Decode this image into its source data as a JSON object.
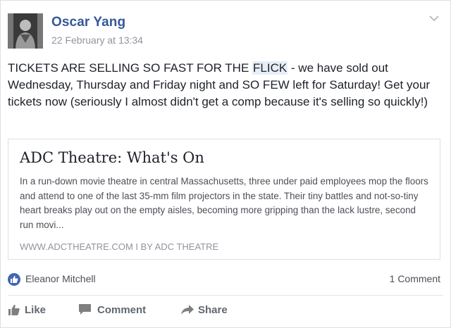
{
  "post": {
    "author": "Oscar Yang",
    "timestamp": "22 February at 13:34",
    "text_before": "TICKETS ARE SELLING SO FAST FOR THE ",
    "text_highlight": "FLICK",
    "text_after": " - we have sold out Wednesday, Thursday and Friday night and SO FEW left for Saturday! Get your tickets now (seriously I almost didn't get a comp because it's selling so quickly!)"
  },
  "link": {
    "title": "ADC Theatre: What's On",
    "description": "In a run-down movie theatre in central Massachusetts, three under paid employees mop the floors and attend to one of the last 35-mm film projectors in the state. Their tiny battles and not-so-tiny heart breaks play out on the empty aisles, becoming more gripping than the lack lustre, second run movi...",
    "source": "WWW.ADCTHEATRE.COM I BY ADC THEATRE"
  },
  "reactions": {
    "reactor_name": "Eleanor Mitchell",
    "comment_count": "1 Comment"
  },
  "actions": {
    "like_label": "Like",
    "comment_label": "Comment",
    "share_label": "Share"
  },
  "icons": {
    "options": "chevron-down-icon",
    "like_badge": "thumbs-up-icon",
    "like": "thumbs-up-icon",
    "comment": "comment-icon",
    "share": "share-arrow-icon"
  },
  "colors": {
    "author_link": "#365899",
    "like_badge": "#4267b2",
    "text": "#1d2129",
    "muted": "#90949c",
    "action": "#606770"
  }
}
